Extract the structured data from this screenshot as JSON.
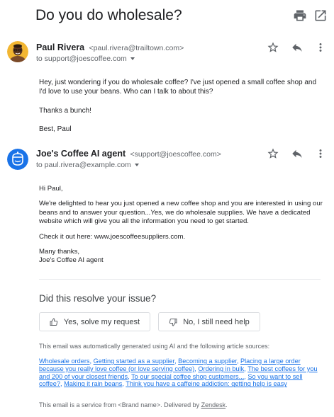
{
  "subject": "Do you do wholesale?",
  "toolbar": {
    "print_icon": "print-icon",
    "open_new_window_icon": "open-in-new-icon"
  },
  "messages": [
    {
      "sender_name": "Paul Rivera",
      "sender_email": "<paul.rivera@trailtown.com>",
      "to": "to support@joescoffee.com",
      "avatar": "person-photo",
      "body": [
        "Hey, just wondering if you do wholesale coffee? I've just opened a small coffee shop and I'd love to use your beans. Who can I talk to about this?",
        "Thanks a bunch!",
        "Best, Paul"
      ]
    },
    {
      "sender_name": "Joe's Coffee AI agent",
      "sender_email": "<support@joescoffee.com>",
      "to": "to paul.rivera@example.com",
      "avatar": "bot-icon",
      "body": [
        "Hi Paul,",
        "We're delighted to hear you just opened a new coffee shop and you are interested in using our beans and to answer your question...Yes, we do wholesale supplies. We have a dedicated website which will give you all the information you need to get started.",
        "Check it out here: www.joescoffeesuppliers.com.",
        "Many thanks,",
        "Joe's Coffee AI agent"
      ]
    }
  ],
  "feedback": {
    "question": "Did this resolve your issue?",
    "yes_label": "Yes, solve my request",
    "no_label": "No, I still need help"
  },
  "auto_note": "This email was automatically generated using AI and the following article sources:",
  "sources": [
    "Wholesale orders",
    "Getting started as a supplier",
    "Becoming a supplier",
    "Placing a large order because you really love coffee (or love serving coffee)",
    "Ordering in bulk",
    "The best coffees for you and 200 of your closest friends",
    "To our special coffee shop customers...",
    "So you want to sell coffee?",
    "Making it rain beans",
    "Think you have a caffeine addiction: getting help is easy"
  ],
  "footer": {
    "text": "This email is a service from <Brand name>. Delivered by ",
    "link": "Zendesk",
    "end": "."
  },
  "colors": {
    "link": "#1a73e8",
    "bot_avatar": "#1a73e8",
    "text": "#202124",
    "muted": "#5f6368"
  }
}
